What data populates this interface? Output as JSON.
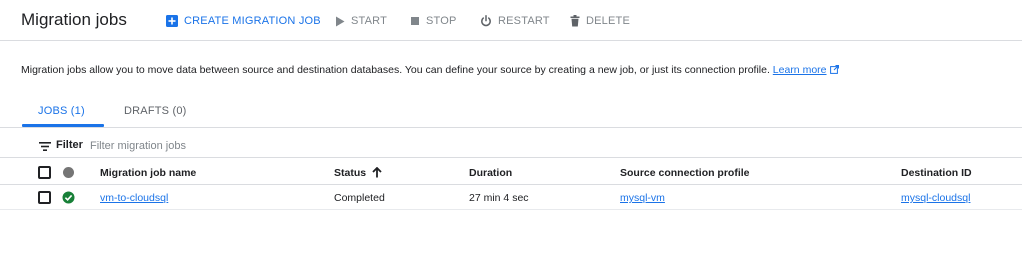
{
  "header": {
    "title": "Migration jobs",
    "create_label": "CREATE MIGRATION JOB",
    "start_label": "START",
    "stop_label": "STOP",
    "restart_label": "RESTART",
    "delete_label": "DELETE"
  },
  "description": {
    "text": "Migration jobs allow you to move data between source and destination databases. You can define your source by creating a new job, or just its connection profile.",
    "link_label": "Learn more"
  },
  "tabs": [
    {
      "label": "JOBS (1)",
      "active": true
    },
    {
      "label": "DRAFTS (0)",
      "active": false
    }
  ],
  "filter": {
    "label": "Filter",
    "placeholder": "Filter migration jobs"
  },
  "table": {
    "columns": [
      "Migration job name",
      "Status",
      "Duration",
      "Source connection profile",
      "Destination ID"
    ],
    "sort_column": "Status",
    "sort_direction": "ascending",
    "rows": [
      {
        "name": "vm-to-cloudsql",
        "status": "Completed",
        "duration": "27 min 4 sec",
        "source": "mysql-vm",
        "destination": "mysql-cloudsql"
      }
    ]
  },
  "colors": {
    "accent": "#1a73e8",
    "success": "#188038",
    "disabled": "#80868b",
    "border": "#dadce0"
  },
  "icons": {
    "create": "add-box-icon",
    "start": "play-icon",
    "stop": "stop-icon",
    "restart": "power-icon",
    "delete": "trash-icon",
    "external": "external-link-icon",
    "filter": "filter-list-icon",
    "sort": "arrow-up-icon",
    "status_header": "status-dot-icon",
    "status_row": "check-circle-icon"
  }
}
